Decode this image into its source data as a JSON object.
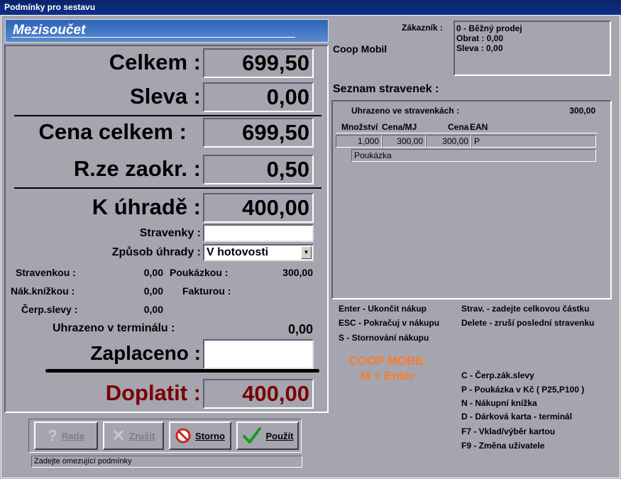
{
  "window": {
    "title": "Podmínky pro sestavu"
  },
  "header": {
    "title": "Mezisoučet"
  },
  "summary": {
    "celkem_label": "Celkem :",
    "celkem_value": "699,50",
    "sleva_label": "Sleva :",
    "sleva_value": "0,00",
    "cena_label": "Cena celkem :",
    "cena_value": "699,50",
    "zaokr_label": "R.ze zaokr. :",
    "zaokr_value": "0,50",
    "uhrade_label": "K úhradě :",
    "uhrade_value": "400,00",
    "stravenky_label": "Stravenky :",
    "stravenky_value": "",
    "zpusob_label": "Způsob úhrady :",
    "zpusob_value": "V hotovosti",
    "stravenkou_label": "Stravenkou :",
    "stravenkou_value": "0,00",
    "poukazkou_label": "Poukázkou :",
    "poukazkou_value": "300,00",
    "knizkou_label": "Nák.knížkou :",
    "knizkou_value": "0,00",
    "fakturou_label": "Fakturou :",
    "cerp_label": "Čerp.slevy :",
    "cerp_value": "0,00",
    "terminal_label": "Uhrazeno v terminálu :",
    "terminal_value": "0,00",
    "zaplaceno_label": "Zaplaceno :",
    "zaplaceno_value": "",
    "doplatit_label": "Doplatit :",
    "doplatit_value": "400,00"
  },
  "customer": {
    "label": "Zákazník :",
    "store": "Coop Mobil",
    "line1": "0 - Běžný prodej",
    "line2": "Obrat : 0,00",
    "line3": "Sleva : 0,00"
  },
  "vouchers": {
    "title": "Seznam stravenek :",
    "paid_label": "Uhrazeno ve stravenkách :",
    "paid_value": "300,00",
    "col_qty": "Množství",
    "col_price": "Cena/MJ",
    "col_total": "Cena",
    "col_ean": "EAN",
    "row_qty": "1,000",
    "row_price": "300,00",
    "row_total": "300,00",
    "row_ean": "P",
    "row_name": "Poukázka"
  },
  "hints": {
    "enter": "Enter - Ukončit nákup",
    "esc": "ESC - Pokračuj v nákupu",
    "s": "S - Stornování nákupu",
    "strav": "Strav. - zadejte celkovou částku",
    "delete": "Delete - zruší poslední stravenku",
    "coop1": "COOP MOBIL",
    "coop2": "M + Enter",
    "c": "C - Čerp.zák.slevy",
    "p": "P - Poukázka v Kč ( P25,P100 )",
    "n": "N - Nákupní knížka",
    "d": "D - Dárková karta - terminál",
    "f7": "F7 - Vklad/výběr kartou",
    "f9": "F9 - Změna uživatele"
  },
  "buttons": {
    "rada": "Rada",
    "zrusit": "Zrušit",
    "storno": "Storno",
    "pouzit": "Použít"
  },
  "status": {
    "text": "Zadejte omezující podmínky"
  },
  "colors": {
    "doplatit": "#7a0000",
    "coop": "#ff7a2a",
    "header": "#3a70c0"
  }
}
